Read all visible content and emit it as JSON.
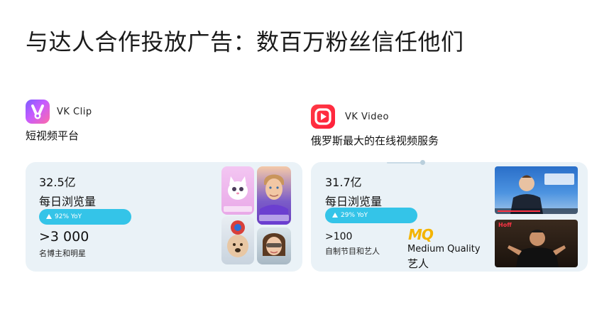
{
  "title": "与达人合作投放广告：数百万粉丝信任他们",
  "vk_clip": {
    "icon": "vk-clip-app-icon",
    "name": "VK  Clip",
    "desc": "短视频平台",
    "card": {
      "stat": "32.5亿",
      "stat_label": "每日浏览量",
      "growth": "92% YoY",
      "growth_percent": 92,
      "count_prefix": ">",
      "count_value": "3 000",
      "count_label": "名博主和明星"
    },
    "thumbnails": [
      "cat-clip-thumbnail",
      "young-man-clip-thumbnail",
      "dog-clip-thumbnail",
      "woman-clip-thumbnail"
    ]
  },
  "vk_video": {
    "icon": "vk-video-app-icon",
    "name": "VK  Video",
    "desc": "俄罗斯最大的在线视频服务",
    "card": {
      "stat": "31.7亿",
      "stat_label": "每日浏览量",
      "growth": "29% YoY",
      "growth_percent": 29,
      "count_value": ">100",
      "count_label": "自制节目和艺人",
      "mq_logo": "MQ",
      "mq_name": "Medium Quality",
      "mq_label": "艺人"
    },
    "thumbnails": [
      "interview-video-thumbnail",
      "show-host-video-thumbnail"
    ],
    "thumb_text": "Hoff"
  },
  "colors": {
    "card_bg": "#eaf2f7",
    "pill": "#34c4e8",
    "vk_clip_gradient": [
      "#a35bff",
      "#ff5fa8"
    ],
    "vk_video_red": "#ff2b3e",
    "mq_yellow": "#f4b400"
  }
}
